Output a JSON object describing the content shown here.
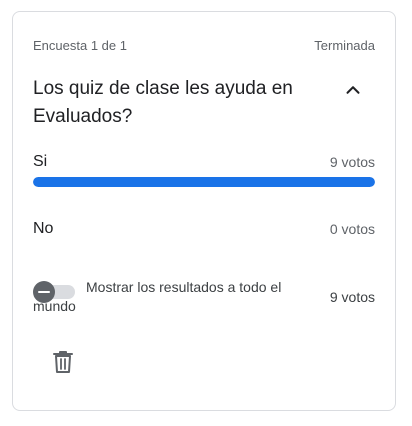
{
  "poll": {
    "counter": "Encuesta 1 de 1",
    "status": "Terminada",
    "question": "Los quiz de clase les ayuda en Evaluados?",
    "options": [
      {
        "label": "Si",
        "votes_text": "9 votos",
        "fraction": 1.0
      },
      {
        "label": "No",
        "votes_text": "0 votos",
        "fraction": 0.0
      }
    ],
    "show_results": {
      "label": "Mostrar los resultados a todo el mundo",
      "enabled": false,
      "votes_text": "9 votos"
    }
  },
  "icons": {
    "collapse": "chevron-up-icon",
    "delete": "trash-icon",
    "toggle_knob": "minus-icon"
  },
  "colors": {
    "accent": "#1a73e8",
    "text_primary": "#202124",
    "text_secondary": "#5f6368",
    "border": "#dadce0"
  }
}
